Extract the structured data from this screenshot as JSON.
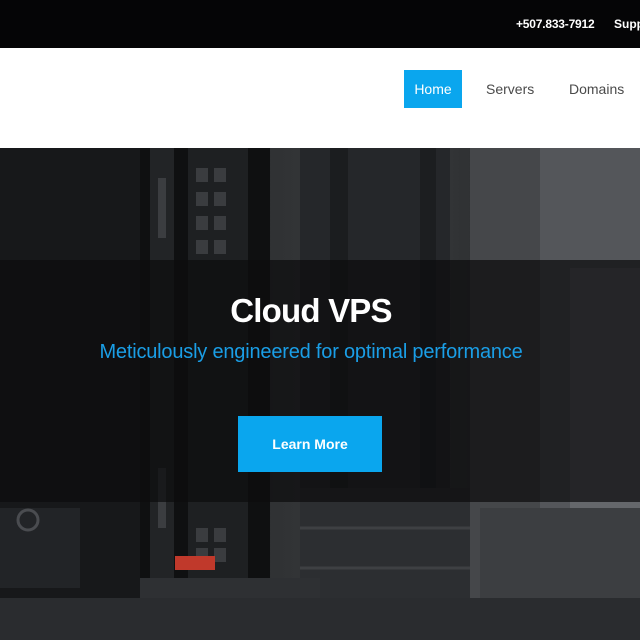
{
  "topbar": {
    "phone": "+507.833-7912",
    "support": "Supp"
  },
  "nav": {
    "items": [
      {
        "label": "Home",
        "active": true
      },
      {
        "label": "Servers",
        "active": false
      },
      {
        "label": "Domains",
        "active": false
      }
    ]
  },
  "hero": {
    "title": "Cloud VPS",
    "subtitle": "Meticulously engineered for optimal performance",
    "cta_label": "Learn More"
  },
  "colors": {
    "accent": "#0aa6ee",
    "topbar_bg": "#050506",
    "subtitle": "#1a9ee6"
  }
}
